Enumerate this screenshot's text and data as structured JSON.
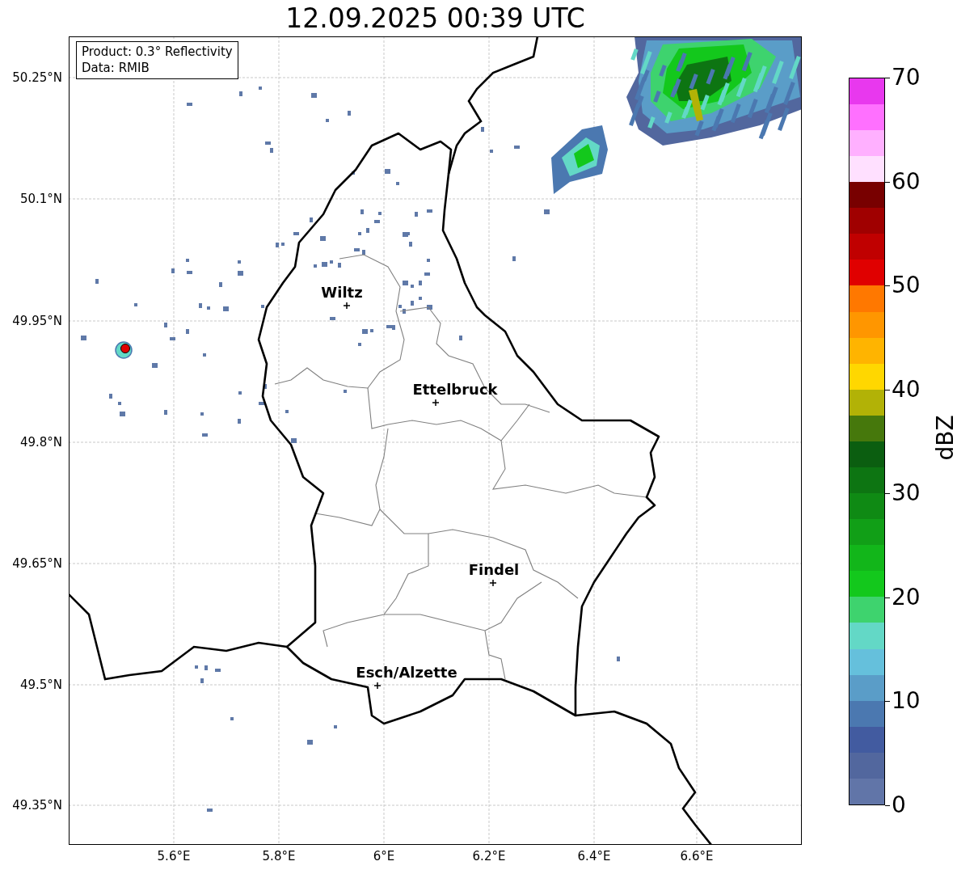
{
  "title": "12.09.2025 00:39 UTC",
  "legend": [
    "Product: 0.3° Reflectivity",
    "Data: RMIB"
  ],
  "cities": [
    {
      "name": "Wiltz"
    },
    {
      "name": "Ettelbruck"
    },
    {
      "name": "Findel"
    },
    {
      "name": "Esch/Alzette"
    }
  ],
  "lat_ticks": [
    "50.25°N",
    "50.1°N",
    "49.95°N",
    "49.8°N",
    "49.65°N",
    "49.5°N",
    "49.35°N"
  ],
  "lon_ticks": [
    "5.6°E",
    "5.8°E",
    "6°E",
    "6.2°E",
    "6.4°E",
    "6.6°E"
  ],
  "colorbar": {
    "label": "dBZ",
    "ticks": [
      "70",
      "60",
      "50",
      "40",
      "30",
      "20",
      "10",
      "0"
    ],
    "segments": [
      {
        "color": "#6175a8"
      },
      {
        "color": "#52679e"
      },
      {
        "color": "#425ba0"
      },
      {
        "color": "#4b78b0"
      },
      {
        "color": "#5a9dc8"
      },
      {
        "color": "#65c0dc"
      },
      {
        "color": "#63d8c6"
      },
      {
        "color": "#3ed36e"
      },
      {
        "color": "#13c81c"
      },
      {
        "color": "#12b61a"
      },
      {
        "color": "#119f17"
      },
      {
        "color": "#0f8a14"
      },
      {
        "color": "#0d7512"
      },
      {
        "color": "#0b5e10"
      },
      {
        "color": "#46780c"
      },
      {
        "color": "#b2b206"
      },
      {
        "color": "#ffd700"
      },
      {
        "color": "#ffb400"
      },
      {
        "color": "#ff9600"
      },
      {
        "color": "#ff7800"
      },
      {
        "color": "#e00000"
      },
      {
        "color": "#c00000"
      },
      {
        "color": "#a00000"
      },
      {
        "color": "#780000"
      },
      {
        "color": "#ffe0ff"
      },
      {
        "color": "#ffb0ff"
      },
      {
        "color": "#ff70ff"
      },
      {
        "color": "#e838ee"
      }
    ]
  }
}
